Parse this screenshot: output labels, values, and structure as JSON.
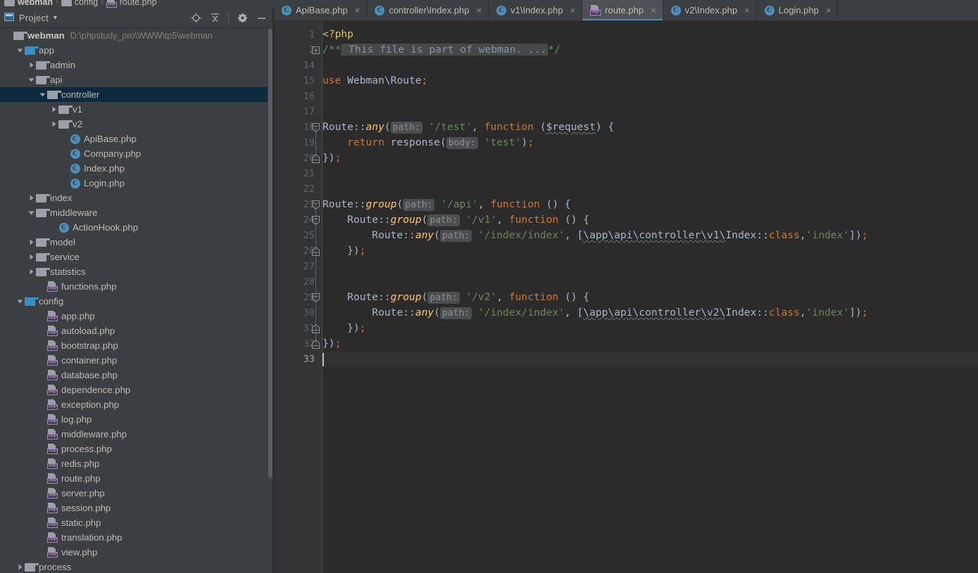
{
  "breadcrumb": {
    "items": [
      {
        "label": "webman",
        "icon": "folder-icon",
        "bold": true
      },
      {
        "label": "config",
        "icon": "folder-icon",
        "bold": false
      },
      {
        "label": "route.php",
        "icon": "php-file-icon",
        "bold": false
      }
    ],
    "separator": "›"
  },
  "panel": {
    "title": "Project",
    "dropdown_caret": "▾",
    "tools": [
      {
        "name": "locate-icon",
        "title": "Select Opened File"
      },
      {
        "name": "collapse-all-icon",
        "title": "Collapse All"
      },
      {
        "name": "gear-icon",
        "title": "Settings"
      },
      {
        "name": "minimize-icon",
        "title": "Hide"
      }
    ]
  },
  "tree": {
    "rows": [
      {
        "indent": 0,
        "arrow": "none",
        "icon": "folder-gray",
        "label": "webman",
        "path": "D:\\phpstudy_pro\\WWW\\tp5\\webman",
        "root": true
      },
      {
        "indent": 1,
        "arrow": "down",
        "icon": "folder-blue",
        "label": "app"
      },
      {
        "indent": 2,
        "arrow": "right",
        "icon": "folder-gray",
        "label": "admin"
      },
      {
        "indent": 2,
        "arrow": "down",
        "icon": "folder-gray",
        "label": "api"
      },
      {
        "indent": 3,
        "arrow": "down",
        "icon": "folder-gray",
        "label": "controller",
        "selected": true
      },
      {
        "indent": 4,
        "arrow": "right",
        "icon": "folder-gray",
        "label": "v1"
      },
      {
        "indent": 4,
        "arrow": "right",
        "icon": "folder-gray",
        "label": "v2"
      },
      {
        "indent": 5,
        "arrow": "none",
        "icon": "php-class",
        "label": "ApiBase.php"
      },
      {
        "indent": 5,
        "arrow": "none",
        "icon": "php-class",
        "label": "Company.php"
      },
      {
        "indent": 5,
        "arrow": "none",
        "icon": "php-class",
        "label": "Index.php"
      },
      {
        "indent": 5,
        "arrow": "none",
        "icon": "php-class",
        "label": "Login.php"
      },
      {
        "indent": 2,
        "arrow": "right",
        "icon": "folder-gray",
        "label": "index"
      },
      {
        "indent": 2,
        "arrow": "down",
        "icon": "folder-gray",
        "label": "middleware"
      },
      {
        "indent": 4,
        "arrow": "none",
        "icon": "php-class",
        "label": "ActionHook.php"
      },
      {
        "indent": 2,
        "arrow": "right",
        "icon": "folder-gray",
        "label": "model"
      },
      {
        "indent": 2,
        "arrow": "right",
        "icon": "folder-gray",
        "label": "service"
      },
      {
        "indent": 2,
        "arrow": "right",
        "icon": "folder-gray",
        "label": "statistics"
      },
      {
        "indent": 3,
        "arrow": "none",
        "icon": "php-file",
        "label": "functions.php"
      },
      {
        "indent": 1,
        "arrow": "down",
        "icon": "folder-blue",
        "label": "config"
      },
      {
        "indent": 3,
        "arrow": "none",
        "icon": "php-file",
        "label": "app.php"
      },
      {
        "indent": 3,
        "arrow": "none",
        "icon": "php-file",
        "label": "autoload.php"
      },
      {
        "indent": 3,
        "arrow": "none",
        "icon": "php-file",
        "label": "bootstrap.php"
      },
      {
        "indent": 3,
        "arrow": "none",
        "icon": "php-file",
        "label": "container.php"
      },
      {
        "indent": 3,
        "arrow": "none",
        "icon": "php-file",
        "label": "database.php"
      },
      {
        "indent": 3,
        "arrow": "none",
        "icon": "php-file",
        "label": "dependence.php"
      },
      {
        "indent": 3,
        "arrow": "none",
        "icon": "php-file",
        "label": "exception.php"
      },
      {
        "indent": 3,
        "arrow": "none",
        "icon": "php-file",
        "label": "log.php"
      },
      {
        "indent": 3,
        "arrow": "none",
        "icon": "php-file",
        "label": "middleware.php"
      },
      {
        "indent": 3,
        "arrow": "none",
        "icon": "php-file",
        "label": "process.php"
      },
      {
        "indent": 3,
        "arrow": "none",
        "icon": "php-file",
        "label": "redis.php"
      },
      {
        "indent": 3,
        "arrow": "none",
        "icon": "php-file",
        "label": "route.php"
      },
      {
        "indent": 3,
        "arrow": "none",
        "icon": "php-file",
        "label": "server.php"
      },
      {
        "indent": 3,
        "arrow": "none",
        "icon": "php-file",
        "label": "session.php"
      },
      {
        "indent": 3,
        "arrow": "none",
        "icon": "php-file",
        "label": "static.php"
      },
      {
        "indent": 3,
        "arrow": "none",
        "icon": "php-file",
        "label": "translation.php"
      },
      {
        "indent": 3,
        "arrow": "none",
        "icon": "php-file",
        "label": "view.php"
      },
      {
        "indent": 1,
        "arrow": "right",
        "icon": "folder-gray",
        "label": "process"
      }
    ]
  },
  "tabs": [
    {
      "label": "ApiBase.php",
      "icon": "php-class",
      "active": false,
      "close": "×"
    },
    {
      "label": "controller\\Index.php",
      "icon": "php-class",
      "active": false,
      "close": "×"
    },
    {
      "label": "v1\\Index.php",
      "icon": "php-class",
      "active": false,
      "close": "×"
    },
    {
      "label": "route.php",
      "icon": "php-file",
      "active": true,
      "close": "×"
    },
    {
      "label": "v2\\Index.php",
      "icon": "php-class",
      "active": false,
      "close": "×"
    },
    {
      "label": "Login.php",
      "icon": "php-class",
      "active": false,
      "close": "×"
    }
  ],
  "editor": {
    "active_file": "route.php",
    "cursor_line": 33,
    "line_numbers": [
      1,
      2,
      14,
      15,
      16,
      17,
      18,
      19,
      20,
      21,
      22,
      23,
      24,
      25,
      26,
      27,
      28,
      29,
      30,
      31,
      32,
      33
    ],
    "lines": [
      {
        "n": 1,
        "fold": "none",
        "tokens": [
          {
            "c": "t-tag",
            "s": "<?php"
          }
        ]
      },
      {
        "n": 2,
        "fold": "collapsed",
        "tokens": [
          {
            "c": "t-cmt",
            "s": "/**"
          },
          {
            "c": "t-fold",
            "s": " This file is part of webman. ..."
          },
          {
            "c": "t-cmt",
            "s": "*/"
          }
        ]
      },
      {
        "n": 14,
        "fold": "none",
        "tokens": []
      },
      {
        "n": 15,
        "fold": "none",
        "tokens": [
          {
            "c": "t-kw",
            "s": "use "
          },
          {
            "c": "t-id",
            "s": "Webman\\Route"
          },
          {
            "c": "t-semi",
            "s": ";"
          }
        ]
      },
      {
        "n": 16,
        "fold": "none",
        "tokens": []
      },
      {
        "n": 17,
        "fold": "none",
        "tokens": []
      },
      {
        "n": 18,
        "fold": "open",
        "tokens": [
          {
            "c": "t-cls",
            "s": "Route"
          },
          {
            "c": "t-punct",
            "s": "::"
          },
          {
            "c": "t-fn",
            "s": "any"
          },
          {
            "c": "t-punct",
            "s": "("
          },
          {
            "c": "t-hint",
            "s": "path:"
          },
          {
            "c": "t-punct",
            "s": " "
          },
          {
            "c": "t-str",
            "s": "'/test'"
          },
          {
            "c": "t-punct",
            "s": ", "
          },
          {
            "c": "t-kw",
            "s": "function"
          },
          {
            "c": "t-punct",
            "s": " ("
          },
          {
            "c": "t-id sq",
            "s": "$request"
          },
          {
            "c": "t-punct",
            "s": ") {"
          }
        ]
      },
      {
        "n": 19,
        "fold": "none",
        "tokens": [
          {
            "c": "t-punct",
            "s": "    "
          },
          {
            "c": "t-kw",
            "s": "return"
          },
          {
            "c": "t-punct",
            "s": " "
          },
          {
            "c": "t-cls",
            "s": "response"
          },
          {
            "c": "t-punct",
            "s": "("
          },
          {
            "c": "t-hint",
            "s": "body:"
          },
          {
            "c": "t-punct",
            "s": " "
          },
          {
            "c": "t-str",
            "s": "'test'"
          },
          {
            "c": "t-punct",
            "s": ")"
          },
          {
            "c": "t-semi",
            "s": ";"
          }
        ]
      },
      {
        "n": 20,
        "fold": "end",
        "tokens": [
          {
            "c": "t-punct",
            "s": "})"
          },
          {
            "c": "t-semi",
            "s": ";"
          }
        ]
      },
      {
        "n": 21,
        "fold": "none",
        "tokens": []
      },
      {
        "n": 22,
        "fold": "none",
        "tokens": []
      },
      {
        "n": 23,
        "fold": "open",
        "tokens": [
          {
            "c": "t-cls",
            "s": "Route"
          },
          {
            "c": "t-punct",
            "s": "::"
          },
          {
            "c": "t-fn",
            "s": "group"
          },
          {
            "c": "t-punct",
            "s": "("
          },
          {
            "c": "t-hint",
            "s": "path:"
          },
          {
            "c": "t-punct",
            "s": " "
          },
          {
            "c": "t-str",
            "s": "'/api'"
          },
          {
            "c": "t-punct",
            "s": ", "
          },
          {
            "c": "t-kw",
            "s": "function"
          },
          {
            "c": "t-punct",
            "s": " () {"
          }
        ]
      },
      {
        "n": 24,
        "fold": "open",
        "tokens": [
          {
            "c": "t-punct",
            "s": "    "
          },
          {
            "c": "t-cls",
            "s": "Route"
          },
          {
            "c": "t-punct",
            "s": "::"
          },
          {
            "c": "t-fn",
            "s": "group"
          },
          {
            "c": "t-punct",
            "s": "("
          },
          {
            "c": "t-hint",
            "s": "path:"
          },
          {
            "c": "t-punct",
            "s": " "
          },
          {
            "c": "t-str",
            "s": "'/v1'"
          },
          {
            "c": "t-punct",
            "s": ", "
          },
          {
            "c": "t-kw",
            "s": "function"
          },
          {
            "c": "t-punct",
            "s": " () {"
          }
        ]
      },
      {
        "n": 25,
        "fold": "none",
        "tokens": [
          {
            "c": "t-punct",
            "s": "        "
          },
          {
            "c": "t-cls",
            "s": "Route"
          },
          {
            "c": "t-punct",
            "s": "::"
          },
          {
            "c": "t-fn",
            "s": "any"
          },
          {
            "c": "t-punct",
            "s": "("
          },
          {
            "c": "t-hint",
            "s": "path:"
          },
          {
            "c": "t-punct",
            "s": " "
          },
          {
            "c": "t-str",
            "s": "'/index/index'"
          },
          {
            "c": "t-punct",
            "s": ", ["
          },
          {
            "c": "t-id sq",
            "s": "\\app\\api\\controller\\v1\\"
          },
          {
            "c": "t-cls",
            "s": "Index"
          },
          {
            "c": "t-punct",
            "s": "::"
          },
          {
            "c": "t-kw",
            "s": "class"
          },
          {
            "c": "t-punct",
            "s": ","
          },
          {
            "c": "t-str",
            "s": "'index'"
          },
          {
            "c": "t-punct",
            "s": "])"
          },
          {
            "c": "t-semi",
            "s": ";"
          }
        ]
      },
      {
        "n": 26,
        "fold": "end",
        "tokens": [
          {
            "c": "t-punct",
            "s": "    })"
          },
          {
            "c": "t-semi",
            "s": ";"
          }
        ]
      },
      {
        "n": 27,
        "fold": "none",
        "tokens": []
      },
      {
        "n": 28,
        "fold": "none",
        "tokens": []
      },
      {
        "n": 29,
        "fold": "open",
        "tokens": [
          {
            "c": "t-punct",
            "s": "    "
          },
          {
            "c": "t-cls",
            "s": "Route"
          },
          {
            "c": "t-punct",
            "s": "::"
          },
          {
            "c": "t-fn",
            "s": "group"
          },
          {
            "c": "t-punct",
            "s": "("
          },
          {
            "c": "t-hint",
            "s": "path:"
          },
          {
            "c": "t-punct",
            "s": " "
          },
          {
            "c": "t-str",
            "s": "'/v2'"
          },
          {
            "c": "t-punct",
            "s": ", "
          },
          {
            "c": "t-kw",
            "s": "function"
          },
          {
            "c": "t-punct",
            "s": " () {"
          }
        ]
      },
      {
        "n": 30,
        "fold": "none",
        "tokens": [
          {
            "c": "t-punct",
            "s": "        "
          },
          {
            "c": "t-cls",
            "s": "Route"
          },
          {
            "c": "t-punct",
            "s": "::"
          },
          {
            "c": "t-fn",
            "s": "any"
          },
          {
            "c": "t-punct",
            "s": "("
          },
          {
            "c": "t-hint",
            "s": "path:"
          },
          {
            "c": "t-punct",
            "s": " "
          },
          {
            "c": "t-str",
            "s": "'/index/index'"
          },
          {
            "c": "t-punct",
            "s": ", ["
          },
          {
            "c": "t-id sq",
            "s": "\\app\\api\\controller\\v2\\"
          },
          {
            "c": "t-cls",
            "s": "Index"
          },
          {
            "c": "t-punct",
            "s": "::"
          },
          {
            "c": "t-kw",
            "s": "class"
          },
          {
            "c": "t-punct",
            "s": ","
          },
          {
            "c": "t-str",
            "s": "'index'"
          },
          {
            "c": "t-punct",
            "s": "])"
          },
          {
            "c": "t-semi",
            "s": ";"
          }
        ]
      },
      {
        "n": 31,
        "fold": "end",
        "tokens": [
          {
            "c": "t-punct",
            "s": "    })"
          },
          {
            "c": "t-semi",
            "s": ";"
          }
        ]
      },
      {
        "n": 32,
        "fold": "end",
        "tokens": [
          {
            "c": "t-punct",
            "s": "})"
          },
          {
            "c": "t-semi",
            "s": ";"
          }
        ]
      },
      {
        "n": 33,
        "fold": "none",
        "current": true,
        "tokens": []
      }
    ]
  },
  "colors": {
    "panel_bg": "#3c3f41",
    "editor_bg": "#2b2b2b",
    "gutter_bg": "#313335",
    "selection_bg": "#0d293e",
    "active_tab_bg": "#4e5254",
    "accent": "#4a88c7",
    "text": "#bbbbbb",
    "keyword": "#cc7832",
    "string": "#6a8759",
    "comment": "#629755",
    "function": "#ffc66d"
  }
}
